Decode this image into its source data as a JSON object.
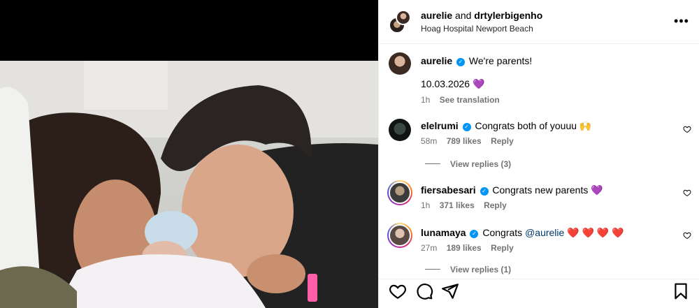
{
  "post": {
    "header": {
      "author": "aurelie",
      "joiner": "and",
      "coauthor": "drtylerbigenho",
      "location": "Hoag Hospital Newport Beach",
      "more_label": "•••"
    },
    "caption": {
      "username": "aurelie",
      "text": "We're parents!",
      "date_line": "10.03.2026",
      "date_emoji": "💜",
      "time": "1h",
      "see_translation": "See translation"
    },
    "comments": [
      {
        "username": "elelrumi",
        "text": "Congrats both of youuu",
        "emoji": "🙌",
        "time": "58m",
        "likes": "789 likes",
        "reply": "Reply",
        "view_replies": "View replies (3)"
      },
      {
        "username": "fiersabesari",
        "text": "Congrats new parents",
        "emoji": "💜",
        "time": "1h",
        "likes": "371 likes",
        "reply": "Reply"
      },
      {
        "username": "lunamaya",
        "text": "Congrats",
        "mention": "@aurelie",
        "emoji": "❤️ ❤️ ❤️ ❤️",
        "time": "27m",
        "likes": "189 likes",
        "reply": "Reply",
        "view_replies": "View replies (1)"
      }
    ],
    "icons": {
      "like": "heart-icon",
      "comment": "comment-icon",
      "share": "paper-plane-icon",
      "save": "bookmark-icon",
      "verified": "verified-badge-icon"
    },
    "colors": {
      "accent_blue": "#0095f6",
      "muted_text": "#737373",
      "mention": "#00376b",
      "heart_red": "#ed4956"
    }
  }
}
